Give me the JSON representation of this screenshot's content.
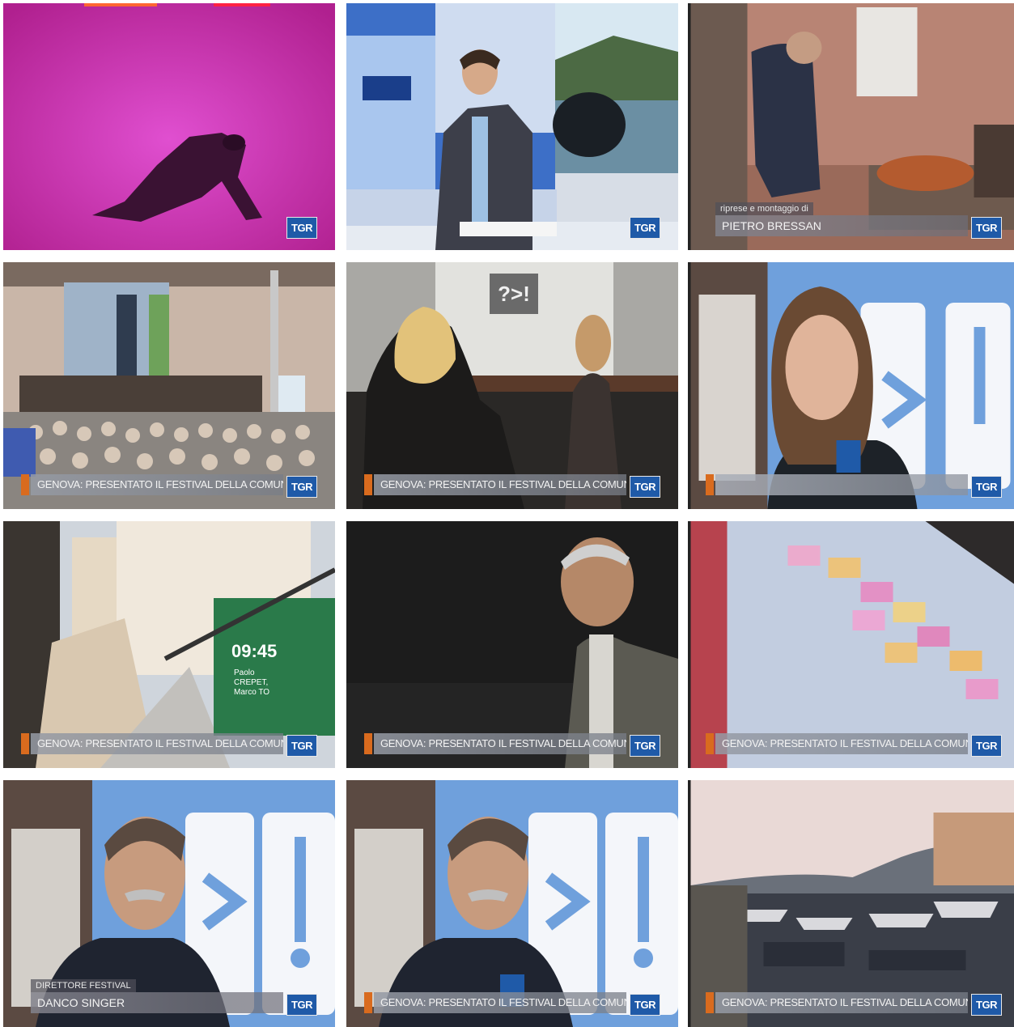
{
  "lower_third": "GENOVA: PRESENTATO IL FESTIVAL DELLA COMUNICAZIONE",
  "tgr_logo": "TGR",
  "credits": {
    "label": "riprese e montaggio di",
    "name": "PIETRO BRESSAN"
  },
  "interview": {
    "role": "DIRETTORE FESTIVAL",
    "name": "DANCO SINGER"
  },
  "stage_screen": {
    "time": "09:45",
    "speaker": "Paolo CREPET, Marco TO"
  },
  "logo_glyph": "?>!",
  "colors": {
    "tgr_blue": "#1f5aa8",
    "accent_orange": "#d96b1e",
    "festival_blue": "#6fa0dc"
  }
}
